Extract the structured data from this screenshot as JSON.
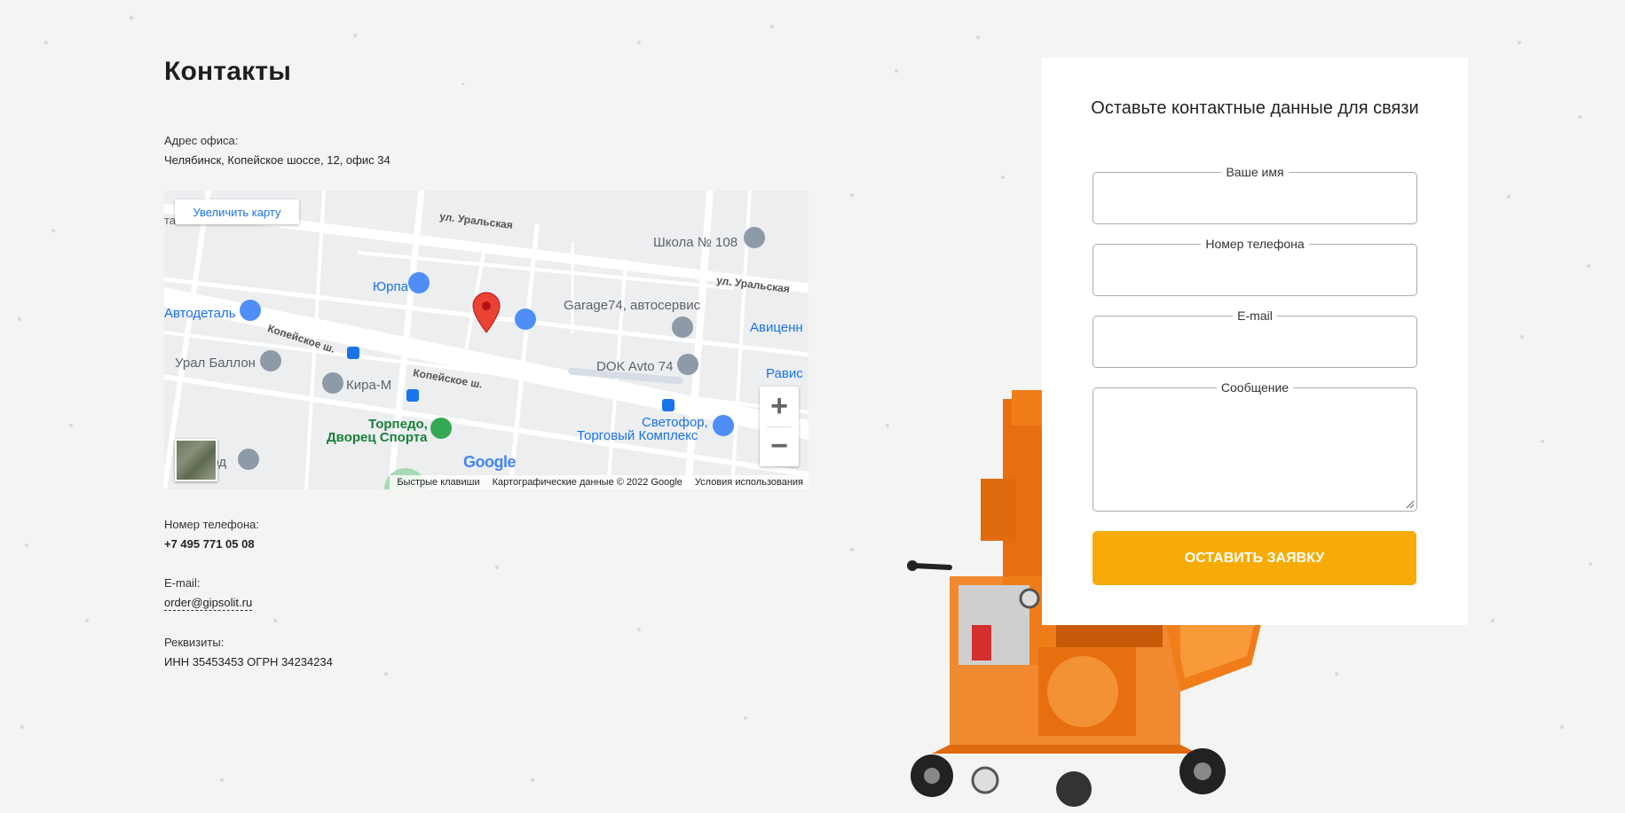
{
  "page": {
    "title": "Контакты"
  },
  "contacts": {
    "address_label": "Адрес офиса:",
    "address_value": "Челябинск, Копейское шоссе, 12, офис 34",
    "phone_label": "Номер телефона:",
    "phone_value": "+7 495 771 05 08",
    "email_label": "E-mail:",
    "email_value": "order@gipsolit.ru",
    "requisites_label": "Реквизиты:",
    "requisites_value": "ИНН 35453453 ОГРН 34234234"
  },
  "map": {
    "enlarge_label": "Увеличить карту",
    "zoom_in_label": "+",
    "zoom_out_label": "−",
    "google_logo": "Google",
    "attribution": {
      "shortcuts": "Быстрые клавиши",
      "data": "Картографические данные © 2022 Google",
      "terms": "Условия использования"
    },
    "places": [
      {
        "name": "Школа № 108",
        "style": "grey"
      },
      {
        "name": "Юрпа",
        "style": "blue"
      },
      {
        "name": "Автодеталь",
        "style": "blue"
      },
      {
        "name": "Garage74, автосервис",
        "style": "grey"
      },
      {
        "name": "Авиценн",
        "style": "blue"
      },
      {
        "name": "Урал Баллон",
        "style": "grey"
      },
      {
        "name": "DOK Avto 74",
        "style": "grey"
      },
      {
        "name": "Равис",
        "style": "blue"
      },
      {
        "name": "Кира-М",
        "style": "grey"
      },
      {
        "name": "Торпедо,",
        "style": "green"
      },
      {
        "name": "Дворец Спорта",
        "style": "green"
      },
      {
        "name": "Светофор,",
        "style": "blue"
      },
      {
        "name": "Торговый Комплекс",
        "style": "blue"
      },
      {
        "name": "орд",
        "style": "grey"
      },
      {
        "name": "та",
        "style": "grey"
      }
    ],
    "streets": [
      "ул. Уральская",
      "ул. Уральская",
      "Копейское ш.",
      "Копейское ш."
    ]
  },
  "form": {
    "title": "Оставьте контактные данные для связи",
    "name_label": "Ваше имя",
    "phone_label": "Номер телефона",
    "email_label": "E-mail",
    "message_label": "Сообщение",
    "submit_label": "ОСТАВИТЬ ЗАЯВКУ"
  },
  "colors": {
    "accent": "#f7ab08",
    "map_blue": "#1a73e8",
    "marker_red": "#ea4335",
    "machine_orange": "#f07d1a"
  },
  "icons": [
    "map-pin-icon",
    "zoom-in-icon",
    "zoom-out-icon",
    "resize-grip-icon"
  ]
}
